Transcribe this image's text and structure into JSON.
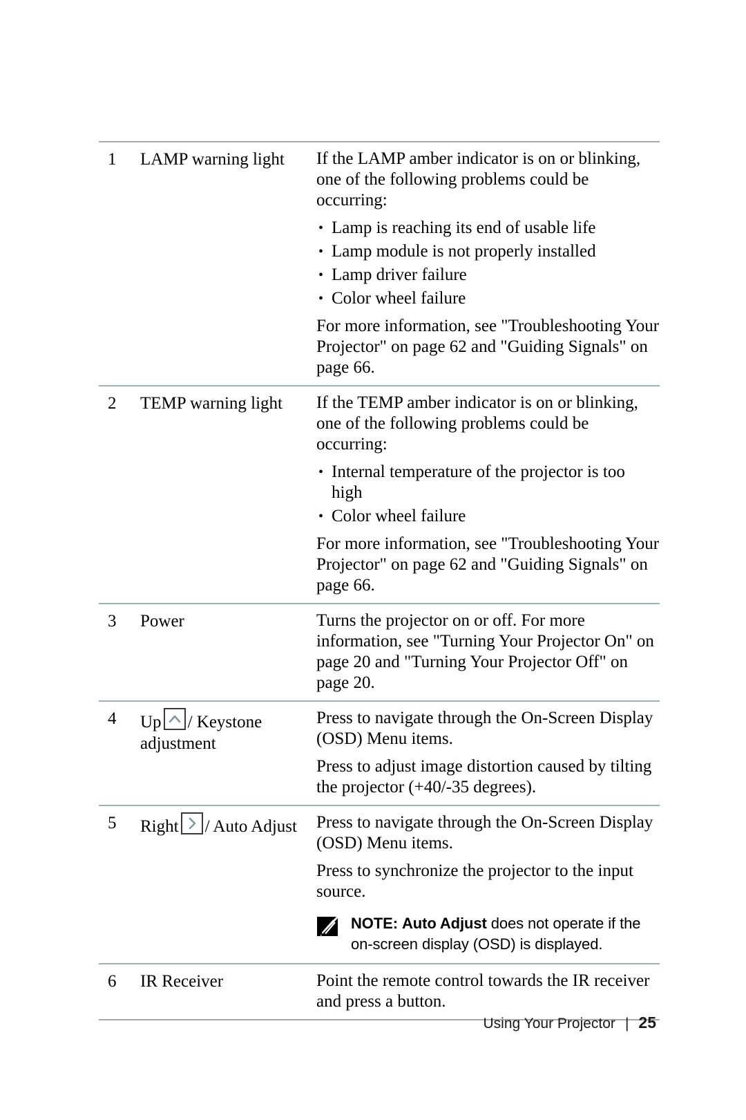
{
  "document": {
    "footer": {
      "section_title": "Using Your Projector",
      "separator": "|",
      "page_number": "25"
    }
  },
  "table": {
    "rows": [
      {
        "number": "1",
        "label": "LAMP warning light",
        "intro": "If the LAMP amber indicator is on or blinking, one of the following problems could be occurring:",
        "bullets": [
          "Lamp is reaching its end of usable life",
          "Lamp module is not properly installed",
          "Lamp driver failure",
          "Color wheel failure"
        ],
        "outro": "For more information, see \"Troubleshooting Your Projector\" on page 62 and \"Guiding Signals\" on page 66."
      },
      {
        "number": "2",
        "label": "TEMP warning light",
        "intro": "If the TEMP amber indicator is on or blinking, one of the following problems could be occurring:",
        "bullets": [
          "Internal temperature of the projector is too high",
          "Color wheel failure"
        ],
        "outro": "For more information, see \"Troubleshooting Your Projector\" on page 62 and \"Guiding Signals\" on page 66."
      },
      {
        "number": "3",
        "label": "Power",
        "body": "Turns the projector on or off. For more information, see \"Turning Your Projector On\" on page 20 and \"Turning Your Projector Off\" on page 20."
      },
      {
        "number": "4",
        "label_before": "Up",
        "label_icon": "up-chevron-key-icon",
        "label_after": "/ Keystone adjustment",
        "body1": "Press to navigate through the On-Screen Display (OSD) Menu items.",
        "body2": "Press to adjust image distortion caused by tilting the projector (+40/-35 degrees)."
      },
      {
        "number": "5",
        "label_before": "Right",
        "label_icon": "right-chevron-key-icon",
        "label_after": "/ Auto Adjust",
        "body1": "Press to navigate through the On-Screen Display (OSD) Menu items.",
        "body2": "Press to synchronize the projector to the input source.",
        "note": {
          "icon": "dell-note-pencil-icon",
          "lead": "NOTE:",
          "emphasis": "Auto Adjust",
          "rest": "does not operate if the on-screen display (OSD) is displayed."
        }
      },
      {
        "number": "6",
        "label": "IR Receiver",
        "body": "Point the remote control towards the IR receiver and press a button."
      }
    ]
  },
  "colors": {
    "rule_grey": "#a8a8a8",
    "rule_teal": "#9eb2ae",
    "text": "#000000",
    "note_icon": "#000000"
  }
}
